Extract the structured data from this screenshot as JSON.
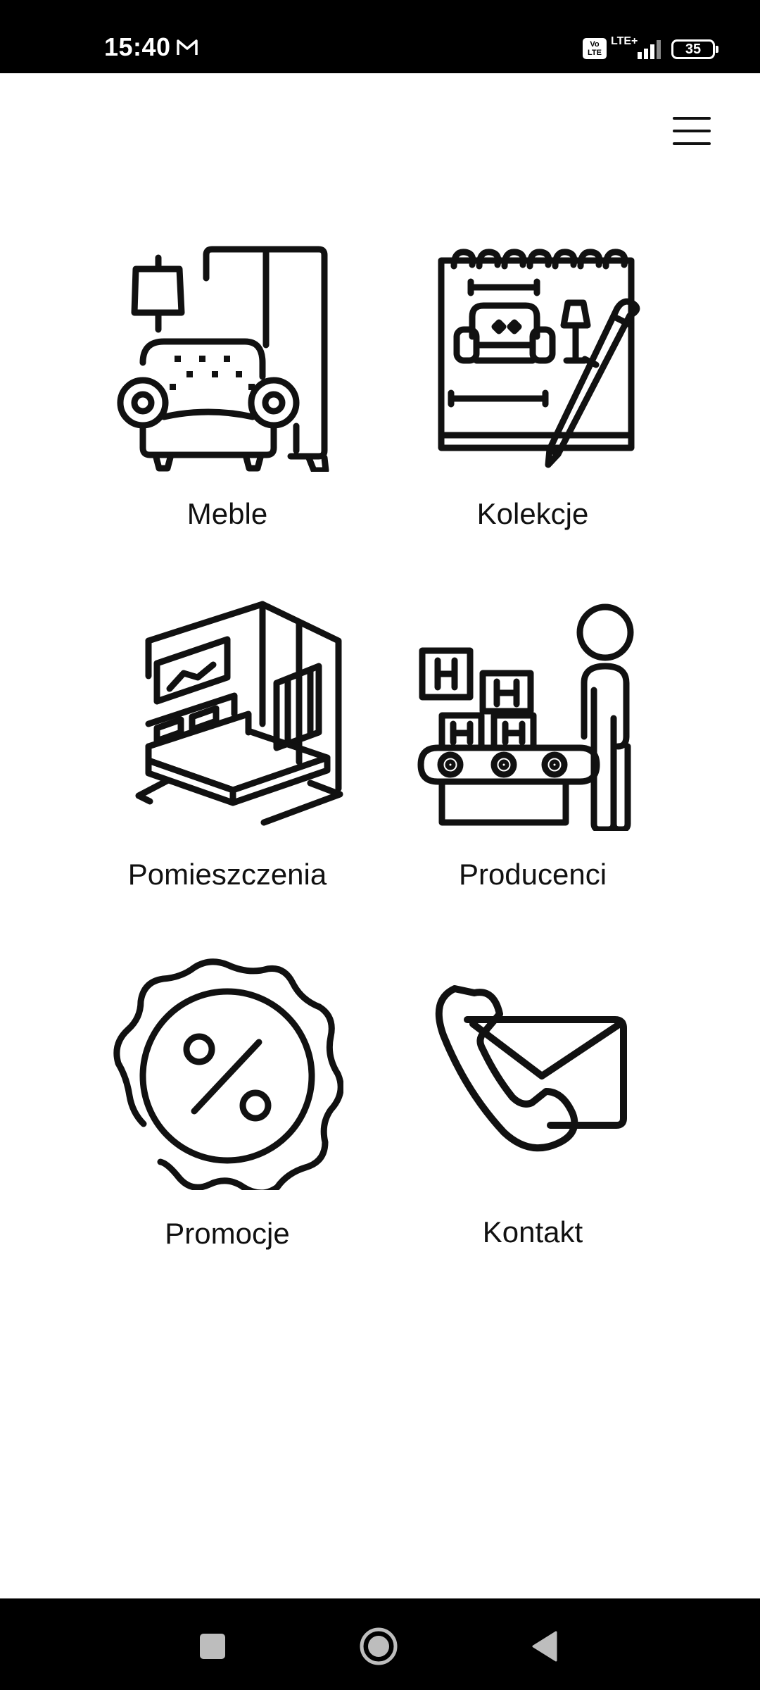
{
  "status_bar": {
    "time": "15:40",
    "volte": "Vo LTE",
    "network": "LTE+",
    "battery": "35"
  },
  "header": {
    "menu_icon": "hamburger-menu-icon"
  },
  "tiles": [
    {
      "label": "Meble",
      "icon": "armchair-wardrobe-icon"
    },
    {
      "label": "Kolekcje",
      "icon": "sketchbook-pencil-icon"
    },
    {
      "label": "Pomieszczenia",
      "icon": "bedroom-interior-icon"
    },
    {
      "label": "Producenci",
      "icon": "factory-worker-conveyor-icon"
    },
    {
      "label": "Promocje",
      "icon": "percent-badge-icon"
    },
    {
      "label": "Kontakt",
      "icon": "phone-envelope-icon"
    }
  ],
  "nav_bar": {
    "recents_icon": "square-icon",
    "home_icon": "circle-icon",
    "back_icon": "triangle-back-icon"
  },
  "colors": {
    "status_bar": "#000000",
    "background": "#ffffff",
    "icon_stroke": "#111111",
    "nav_bar": "#000000"
  }
}
